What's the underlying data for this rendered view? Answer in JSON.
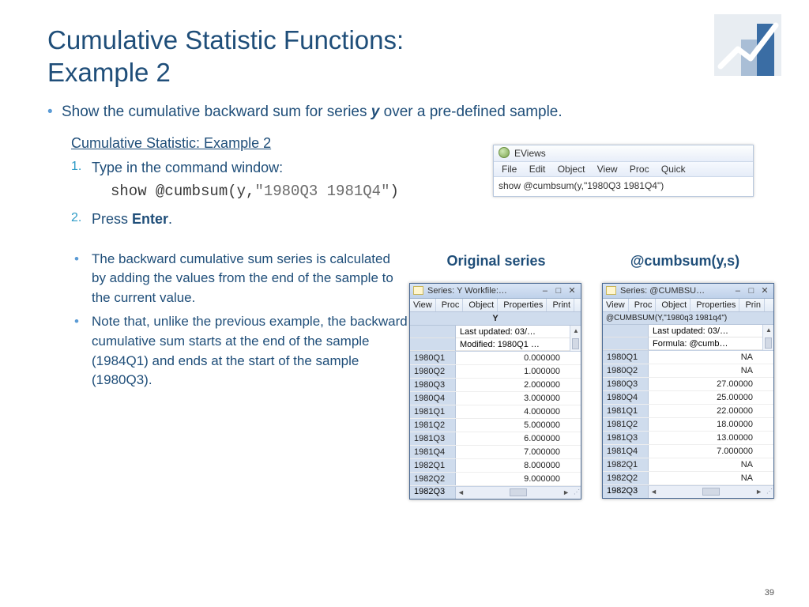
{
  "title_line1": "Cumulative Statistic Functions:",
  "title_line2": "Example 2",
  "main_bullet_pre": "Show the cumulative backward sum for series ",
  "main_bullet_y": "y",
  "main_bullet_post": " over a pre-defined sample.",
  "sub_heading": "Cumulative Statistic: Example 2",
  "step1": {
    "num": "1.",
    "text": "Type in the command window:"
  },
  "code_pre": "show @cumbsum(y,",
  "code_mid": "\"1980Q3 1981Q4\"",
  "code_post": ")",
  "step2": {
    "num": "2.",
    "pre": "Press ",
    "bold": "Enter",
    "post": "."
  },
  "explain": [
    "The backward cumulative sum series is calculated by adding the values from the end of the sample to the current value.",
    "Note that, unlike the previous example, the backward cumulative sum starts at the end of the sample (1984Q1) and ends at the start of the sample (1980Q3)."
  ],
  "cmd_win": {
    "title": "EViews",
    "menu": [
      "File",
      "Edit",
      "Object",
      "View",
      "Proc",
      "Quick"
    ],
    "body": "show @cumbsum(y,\"1980Q3 1981Q4\")"
  },
  "label_orig": "Original series",
  "label_cumb": "@cumbsum(y,s)",
  "win_orig": {
    "title": "Series: Y   Workfile:…",
    "toolbar": [
      "View",
      "Proc",
      "Object",
      "Properties",
      "Print"
    ],
    "header": "Y",
    "meta": [
      "Last updated: 03/…",
      "Modified: 1980Q1 …"
    ],
    "rows": [
      {
        "d": "1980Q1",
        "v": "0.000000"
      },
      {
        "d": "1980Q2",
        "v": "1.000000"
      },
      {
        "d": "1980Q3",
        "v": "2.000000"
      },
      {
        "d": "1980Q4",
        "v": "3.000000"
      },
      {
        "d": "1981Q1",
        "v": "4.000000"
      },
      {
        "d": "1981Q2",
        "v": "5.000000"
      },
      {
        "d": "1981Q3",
        "v": "6.000000"
      },
      {
        "d": "1981Q4",
        "v": "7.000000"
      },
      {
        "d": "1982Q1",
        "v": "8.000000"
      },
      {
        "d": "1982Q2",
        "v": "9.000000"
      }
    ],
    "footer_date": "1982Q3"
  },
  "win_cumb": {
    "title": "Series: @CUMBSU…",
    "toolbar": [
      "View",
      "Proc",
      "Object",
      "Properties",
      "Prin"
    ],
    "header": "@CUMBSUM(Y,\"1980q3 1981q4\")",
    "meta": [
      "Last updated: 03/…",
      "Formula: @cumb…"
    ],
    "rows": [
      {
        "d": "1980Q1",
        "v": "NA"
      },
      {
        "d": "1980Q2",
        "v": "NA"
      },
      {
        "d": "1980Q3",
        "v": "27.00000"
      },
      {
        "d": "1980Q4",
        "v": "25.00000"
      },
      {
        "d": "1981Q1",
        "v": "22.00000"
      },
      {
        "d": "1981Q2",
        "v": "18.00000"
      },
      {
        "d": "1981Q3",
        "v": "13.00000"
      },
      {
        "d": "1981Q4",
        "v": "7.000000"
      },
      {
        "d": "1982Q1",
        "v": "NA"
      },
      {
        "d": "1982Q2",
        "v": "NA"
      }
    ],
    "footer_date": "1982Q3"
  },
  "page_num": "39"
}
